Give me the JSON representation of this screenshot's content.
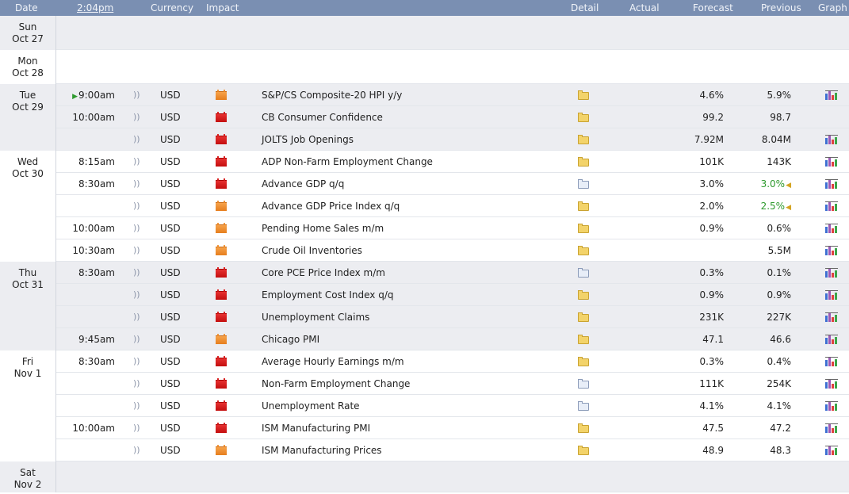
{
  "header": {
    "date": "Date",
    "time": "2:04pm",
    "currency": "Currency",
    "impact": "Impact",
    "detail": "Detail",
    "actual": "Actual",
    "forecast": "Forecast",
    "previous": "Previous",
    "graph": "Graph"
  },
  "colors": {
    "header_bg": "#7a8fb2",
    "shaded_bg": "#ecedf1",
    "white_bg": "#ffffff",
    "better": "#2e9a2e",
    "high_impact": "#c40f0f",
    "medium_impact": "#e67e1e"
  },
  "days": [
    {
      "weekday": "Sun",
      "date": "Oct 27",
      "events": []
    },
    {
      "weekday": "Mon",
      "date": "Oct 28",
      "events": []
    },
    {
      "weekday": "Tue",
      "date": "Oct 29",
      "events": [
        {
          "time": "9:00am",
          "currency": "USD",
          "impact": "medium",
          "name": "S&P/CS Composite-20 HPI y/y",
          "detail": "folder",
          "actual": "",
          "forecast": "4.6%",
          "previous": "5.9%",
          "graph": true,
          "next": true
        },
        {
          "time": "10:00am",
          "currency": "USD",
          "impact": "high",
          "name": "CB Consumer Confidence",
          "detail": "folder",
          "actual": "",
          "forecast": "99.2",
          "previous": "98.7",
          "graph": false
        },
        {
          "time": "",
          "currency": "USD",
          "impact": "high",
          "name": "JOLTS Job Openings",
          "detail": "folder",
          "actual": "",
          "forecast": "7.92M",
          "previous": "8.04M",
          "graph": true
        }
      ]
    },
    {
      "weekday": "Wed",
      "date": "Oct 30",
      "events": [
        {
          "time": "8:15am",
          "currency": "USD",
          "impact": "high",
          "name": "ADP Non-Farm Employment Change",
          "detail": "folder",
          "actual": "",
          "forecast": "101K",
          "previous": "143K",
          "graph": true
        },
        {
          "time": "8:30am",
          "currency": "USD",
          "impact": "high",
          "name": "Advance GDP q/q",
          "detail": "doc",
          "actual": "",
          "forecast": "3.0%",
          "previous": "3.0%",
          "previous_better": true,
          "graph": true
        },
        {
          "time": "",
          "currency": "USD",
          "impact": "medium",
          "name": "Advance GDP Price Index q/q",
          "detail": "folder",
          "actual": "",
          "forecast": "2.0%",
          "previous": "2.5%",
          "previous_better": true,
          "graph": true
        },
        {
          "time": "10:00am",
          "currency": "USD",
          "impact": "medium",
          "name": "Pending Home Sales m/m",
          "detail": "folder",
          "actual": "",
          "forecast": "0.9%",
          "previous": "0.6%",
          "graph": true
        },
        {
          "time": "10:30am",
          "currency": "USD",
          "impact": "medium",
          "name": "Crude Oil Inventories",
          "detail": "folder",
          "actual": "",
          "forecast": "",
          "previous": "5.5M",
          "graph": true
        }
      ]
    },
    {
      "weekday": "Thu",
      "date": "Oct 31",
      "events": [
        {
          "time": "8:30am",
          "currency": "USD",
          "impact": "high",
          "name": "Core PCE Price Index m/m",
          "detail": "doc",
          "actual": "",
          "forecast": "0.3%",
          "previous": "0.1%",
          "graph": true
        },
        {
          "time": "",
          "currency": "USD",
          "impact": "high",
          "name": "Employment Cost Index q/q",
          "detail": "folder",
          "actual": "",
          "forecast": "0.9%",
          "previous": "0.9%",
          "graph": true
        },
        {
          "time": "",
          "currency": "USD",
          "impact": "high",
          "name": "Unemployment Claims",
          "detail": "folder",
          "actual": "",
          "forecast": "231K",
          "previous": "227K",
          "graph": true
        },
        {
          "time": "9:45am",
          "currency": "USD",
          "impact": "medium",
          "name": "Chicago PMI",
          "detail": "folder",
          "actual": "",
          "forecast": "47.1",
          "previous": "46.6",
          "graph": true
        }
      ]
    },
    {
      "weekday": "Fri",
      "date": "Nov 1",
      "events": [
        {
          "time": "8:30am",
          "currency": "USD",
          "impact": "high",
          "name": "Average Hourly Earnings m/m",
          "detail": "folder",
          "actual": "",
          "forecast": "0.3%",
          "previous": "0.4%",
          "graph": true
        },
        {
          "time": "",
          "currency": "USD",
          "impact": "high",
          "name": "Non-Farm Employment Change",
          "detail": "doc",
          "actual": "",
          "forecast": "111K",
          "previous": "254K",
          "graph": true
        },
        {
          "time": "",
          "currency": "USD",
          "impact": "high",
          "name": "Unemployment Rate",
          "detail": "doc",
          "actual": "",
          "forecast": "4.1%",
          "previous": "4.1%",
          "graph": true
        },
        {
          "time": "10:00am",
          "currency": "USD",
          "impact": "high",
          "name": "ISM Manufacturing PMI",
          "detail": "folder",
          "actual": "",
          "forecast": "47.5",
          "previous": "47.2",
          "graph": true
        },
        {
          "time": "",
          "currency": "USD",
          "impact": "medium",
          "name": "ISM Manufacturing Prices",
          "detail": "folder",
          "actual": "",
          "forecast": "48.9",
          "previous": "48.3",
          "graph": true
        }
      ]
    },
    {
      "weekday": "Sat",
      "date": "Nov 2",
      "events": []
    }
  ]
}
